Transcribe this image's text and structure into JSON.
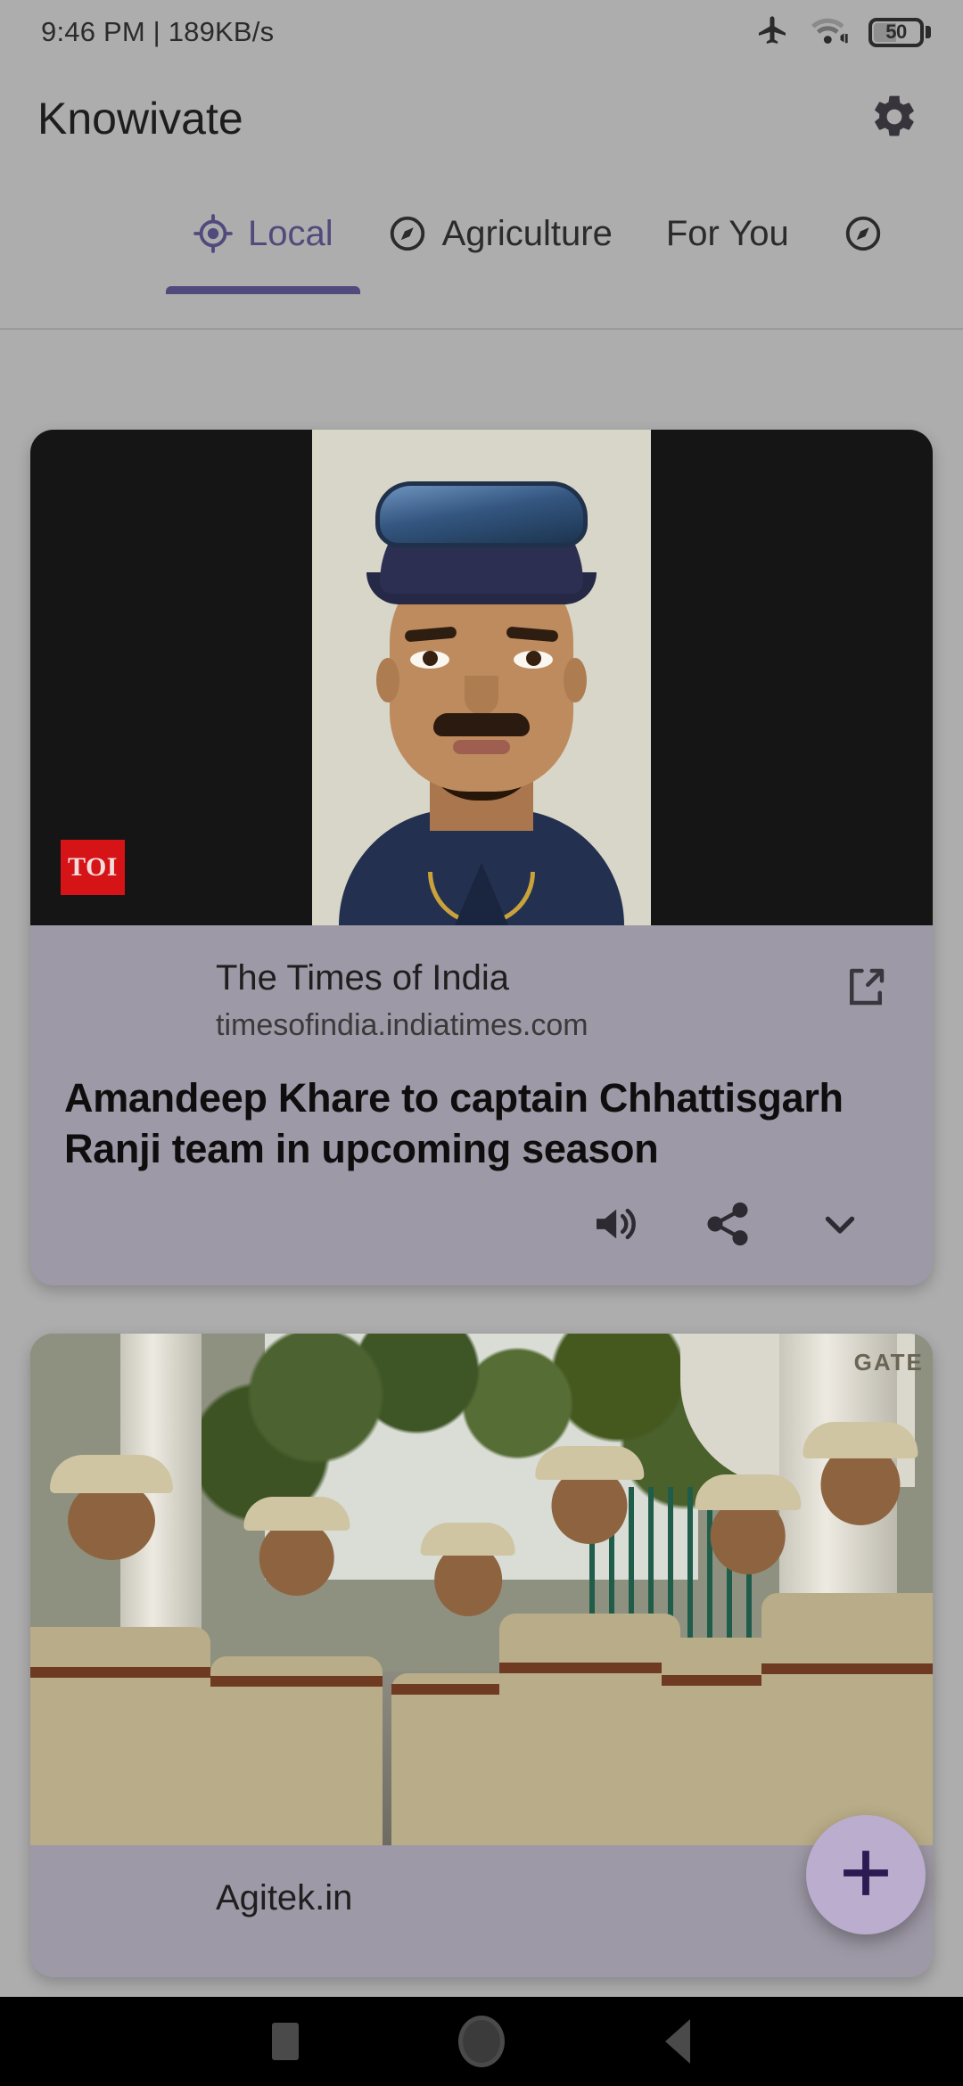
{
  "status_bar": {
    "time_and_speed": "9:46 PM | 189KB/s",
    "airplane_icon": "airplane-mode-icon",
    "wifi_icon": "wifi-icon",
    "battery_level": "50",
    "battery_icon": "battery-icon"
  },
  "app_bar": {
    "title": "Knowivate",
    "settings_icon": "gear-icon"
  },
  "tabs": {
    "items": [
      {
        "label": "Local",
        "icon": "gps-target-icon",
        "active": true
      },
      {
        "label": "Agriculture",
        "icon": "compass-icon",
        "active": false
      },
      {
        "label": "For You",
        "icon": "",
        "active": false
      },
      {
        "label": "",
        "icon": "compass-icon",
        "active": false
      }
    ]
  },
  "feed": {
    "cards": [
      {
        "source_badge": "TOI",
        "source_name": "The Times of India",
        "source_url": "timesofindia.indiatimes.com",
        "headline": "Amandeep Khare to captain Chhattisgarh Ranji team in upcoming season",
        "open_external_icon": "external-link-icon",
        "actions": [
          {
            "icon": "speaker-icon",
            "name": "read-aloud"
          },
          {
            "icon": "share-icon",
            "name": "share"
          },
          {
            "icon": "chevron-down-icon",
            "name": "expand"
          }
        ],
        "image_alt": "Portrait of cricketer wearing navy cap with sunglasses"
      },
      {
        "source_badge": "",
        "source_name": "Agitek.in",
        "source_url": "",
        "headline": "",
        "open_external_icon": "external-link-icon",
        "actions": [],
        "image_alt": "Police officers in khaki uniforms standing near a gate",
        "image_text_overlay": "GATE"
      }
    ]
  },
  "fab": {
    "icon": "plus-icon",
    "label": "add"
  },
  "nav_bar": {
    "recents_icon": "square-recents-icon",
    "home_icon": "circle-home-icon",
    "back_icon": "triangle-back-icon"
  },
  "colors": {
    "accent_purple": "#514A7C",
    "fab_background": "#BBADCD",
    "fab_icon": "#2B1B52",
    "card_background": "#9E99A6",
    "page_background": "#ADADAD",
    "toi_red": "#D61317"
  }
}
